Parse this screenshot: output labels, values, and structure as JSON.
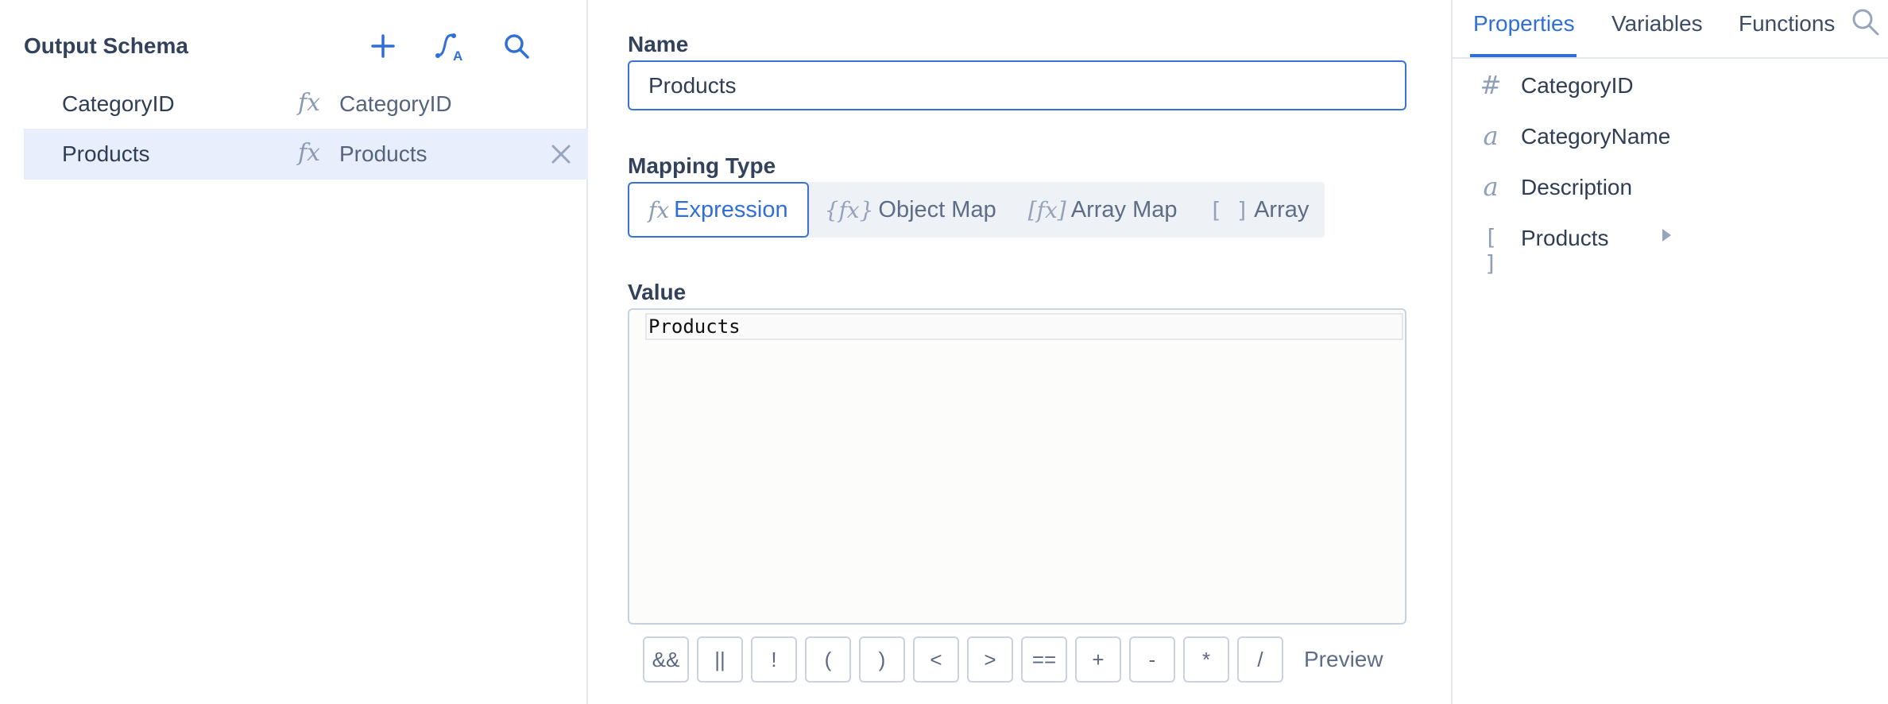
{
  "left": {
    "title": "Output Schema",
    "rows": [
      {
        "name": "CategoryID",
        "fx": "fx",
        "expression": "CategoryID",
        "selected": false
      },
      {
        "name": "Products",
        "fx": "fx",
        "expression": "Products",
        "selected": true
      }
    ]
  },
  "editor": {
    "name_label": "Name",
    "name_value": "Products",
    "mapping_label": "Mapping Type",
    "mapping_types": [
      {
        "icon": "fx",
        "label": "Expression",
        "active": true
      },
      {
        "icon": "{fx}",
        "label": "Object Map",
        "active": false
      },
      {
        "icon": "[fx]",
        "label": "Array Map",
        "active": false
      },
      {
        "icon": "[ ]",
        "label": "Array",
        "active": false
      }
    ],
    "value_label": "Value",
    "value_text": "Products",
    "operators": [
      "&&",
      "||",
      "!",
      "(",
      ")",
      "<",
      ">",
      "==",
      "+",
      "-",
      "*",
      "/"
    ],
    "preview_label": "Preview"
  },
  "right": {
    "tabs": [
      "Properties",
      "Variables",
      "Functions"
    ],
    "active_tab": "Properties",
    "properties": [
      {
        "icon": "#",
        "name": "CategoryID"
      },
      {
        "icon": "a",
        "name": "CategoryName"
      },
      {
        "icon": "a",
        "name": "Description"
      },
      {
        "icon": "[ ]",
        "name": "Products",
        "expandable": true
      }
    ]
  },
  "colors": {
    "accent": "#2f6fd6",
    "selected_row": "#e8eefb",
    "border": "#c9d2de"
  }
}
